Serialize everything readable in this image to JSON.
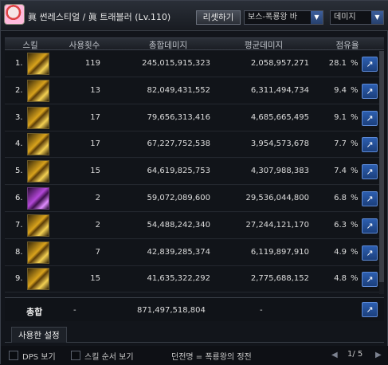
{
  "header": {
    "title": "眞 썬레스티얼 / 眞 트래블러 (Lv.110)",
    "reset_label": "리셋하기",
    "boss_select": "보스-폭룡왕 바",
    "type_select": "데미지"
  },
  "columns": {
    "skill": "스킬",
    "count": "사용횟수",
    "total": "총합데미지",
    "avg": "평균데미지",
    "share": "점유율"
  },
  "rows": [
    {
      "rank": "1.",
      "count": "119",
      "total": "245,015,915,323",
      "avg": "2,058,957,271",
      "pct": "28.1",
      "unit": "%",
      "icon": "sword-gold"
    },
    {
      "rank": "2.",
      "count": "13",
      "total": "82,049,431,552",
      "avg": "6,311,494,734",
      "pct": "9.4",
      "unit": "%",
      "icon": "sword-gold"
    },
    {
      "rank": "3.",
      "count": "17",
      "total": "79,656,313,416",
      "avg": "4,685,665,495",
      "pct": "9.1",
      "unit": "%",
      "icon": "sword-gold"
    },
    {
      "rank": "4.",
      "count": "17",
      "total": "67,227,752,538",
      "avg": "3,954,573,678",
      "pct": "7.7",
      "unit": "%",
      "icon": "sword-gold"
    },
    {
      "rank": "5.",
      "count": "15",
      "total": "64,619,825,753",
      "avg": "4,307,988,383",
      "pct": "7.4",
      "unit": "%",
      "icon": "sword-gold"
    },
    {
      "rank": "6.",
      "count": "2",
      "total": "59,072,089,600",
      "avg": "29,536,044,800",
      "pct": "6.8",
      "unit": "%",
      "icon": "sword-purple"
    },
    {
      "rank": "7.",
      "count": "2",
      "total": "54,488,242,340",
      "avg": "27,244,121,170",
      "pct": "6.3",
      "unit": "%",
      "icon": "sword-gold"
    },
    {
      "rank": "8.",
      "count": "7",
      "total": "42,839,285,374",
      "avg": "6,119,897,910",
      "pct": "4.9",
      "unit": "%",
      "icon": "sword-gold"
    },
    {
      "rank": "9.",
      "count": "15",
      "total": "41,635,322,292",
      "avg": "2,775,688,152",
      "pct": "4.8",
      "unit": "%",
      "icon": "sword-gold"
    }
  ],
  "total": {
    "label": "총합",
    "count": "-",
    "total": "871,497,518,804",
    "avg": "-"
  },
  "tabs": {
    "used_settings": "사용한 설정"
  },
  "footer": {
    "dps_label": "DPS 보기",
    "order_label": "스킬 순서 보기",
    "dungeon": "던전명 = 폭룡왕의 정전",
    "page": "1/ 5",
    "prev": "◀",
    "next": "▶"
  },
  "icons": {
    "share": "share-icon",
    "dropdown": "chevron-down-icon"
  }
}
